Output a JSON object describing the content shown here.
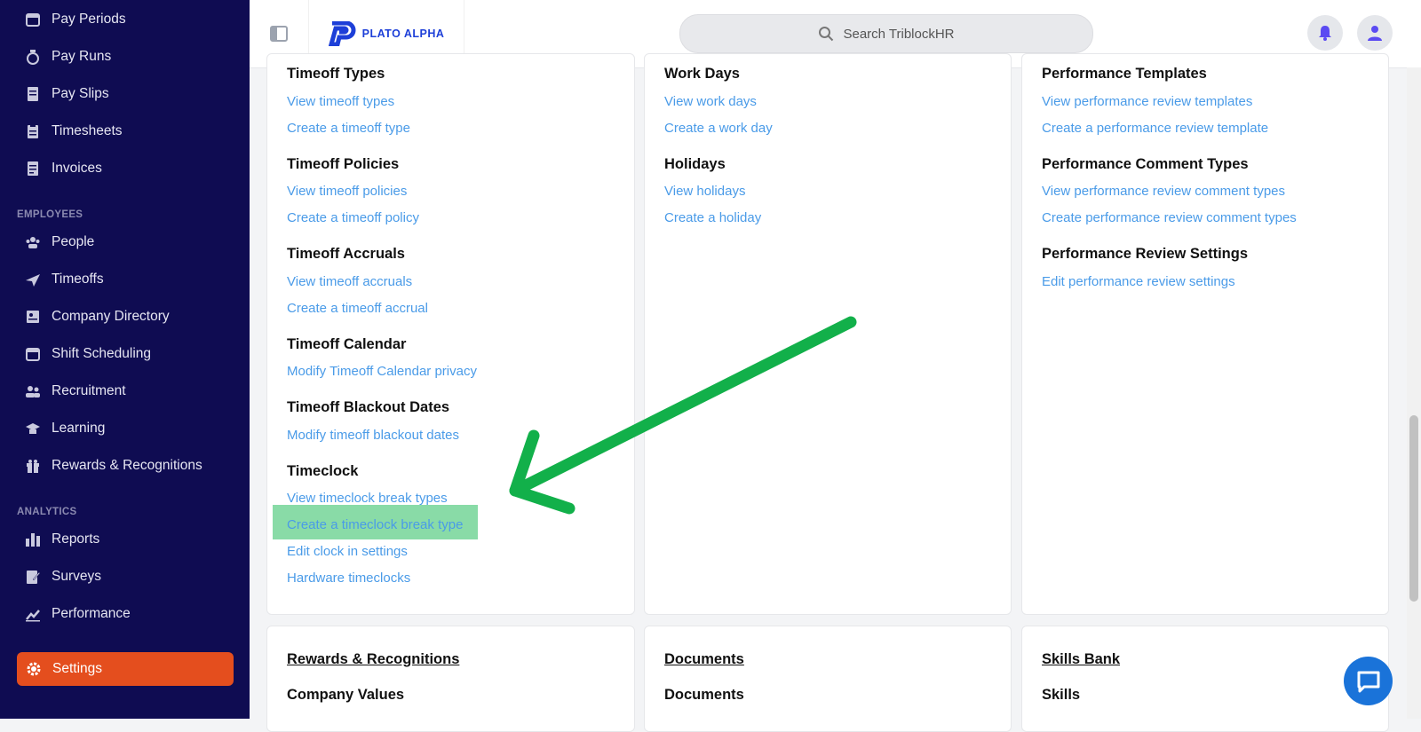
{
  "app": {
    "brand": "PLATO ALPHA",
    "search_placeholder": "Search TriblockHR"
  },
  "sidebar": {
    "items_top": [
      {
        "label": "Pay Periods",
        "icon": "calendar-icon"
      },
      {
        "label": "Pay Runs",
        "icon": "money-bag-icon"
      },
      {
        "label": "Pay Slips",
        "icon": "receipt-icon"
      },
      {
        "label": "Timesheets",
        "icon": "clipboard-icon"
      },
      {
        "label": "Invoices",
        "icon": "invoice-icon"
      }
    ],
    "section_employees": "EMPLOYEES",
    "items_employees": [
      {
        "label": "People",
        "icon": "people-icon"
      },
      {
        "label": "Timeoffs",
        "icon": "plane-icon"
      },
      {
        "label": "Company Directory",
        "icon": "directory-icon"
      },
      {
        "label": "Shift Scheduling",
        "icon": "calendar-icon"
      },
      {
        "label": "Recruitment",
        "icon": "recruit-icon"
      },
      {
        "label": "Learning",
        "icon": "graduation-icon"
      },
      {
        "label": "Rewards & Recognitions",
        "icon": "gift-icon"
      }
    ],
    "section_analytics": "ANALYTICS",
    "items_analytics": [
      {
        "label": "Reports",
        "icon": "bar-chart-icon"
      },
      {
        "label": "Surveys",
        "icon": "survey-icon"
      },
      {
        "label": "Performance",
        "icon": "line-chart-icon"
      }
    ],
    "active": {
      "label": "Settings",
      "icon": "gear-icon"
    }
  },
  "col1": {
    "timeoff_types": {
      "title": "Timeoff Types",
      "links": [
        "View timeoff types",
        "Create a timeoff type"
      ]
    },
    "timeoff_policies": {
      "title": "Timeoff Policies",
      "links": [
        "View timeoff policies",
        "Create a timeoff policy"
      ]
    },
    "timeoff_accruals": {
      "title": "Timeoff Accruals",
      "links": [
        "View timeoff accruals",
        "Create a timeoff accrual"
      ]
    },
    "timeoff_calendar": {
      "title": "Timeoff Calendar",
      "links": [
        "Modify Timeoff Calendar privacy"
      ]
    },
    "timeoff_blackout": {
      "title": "Timeoff Blackout Dates",
      "links": [
        "Modify timeoff blackout dates"
      ]
    },
    "timeclock": {
      "title": "Timeclock",
      "links": [
        "View timeclock break types",
        "Create a timeclock break type",
        "Edit clock in settings",
        "Hardware timeclocks"
      ]
    }
  },
  "col2": {
    "work_days": {
      "title": "Work Days",
      "links": [
        "View work days",
        "Create a work day"
      ]
    },
    "holidays": {
      "title": "Holidays",
      "links": [
        "View holidays",
        "Create a holiday"
      ]
    }
  },
  "col3": {
    "perf_templates": {
      "title": "Performance Templates",
      "links": [
        "View performance review templates",
        "Create a performance review template"
      ]
    },
    "perf_comment_types": {
      "title": "Performance Comment Types",
      "links": [
        "View performance review comment types",
        "Create performance review comment types"
      ]
    },
    "perf_settings": {
      "title": "Performance Review Settings",
      "links": [
        "Edit performance review settings"
      ]
    }
  },
  "bottom": {
    "card1": {
      "section": "Rewards & Recognitions",
      "title": "Company Values"
    },
    "card2": {
      "section": "Documents",
      "title": "Documents"
    },
    "card3": {
      "section": "Skills Bank",
      "title": "Skills"
    }
  },
  "colors": {
    "sidebar_bg": "#0f0c52",
    "active": "#e44e1e",
    "link": "#4a9be8",
    "highlight": "#4ac878",
    "arrow": "#12b04a"
  }
}
